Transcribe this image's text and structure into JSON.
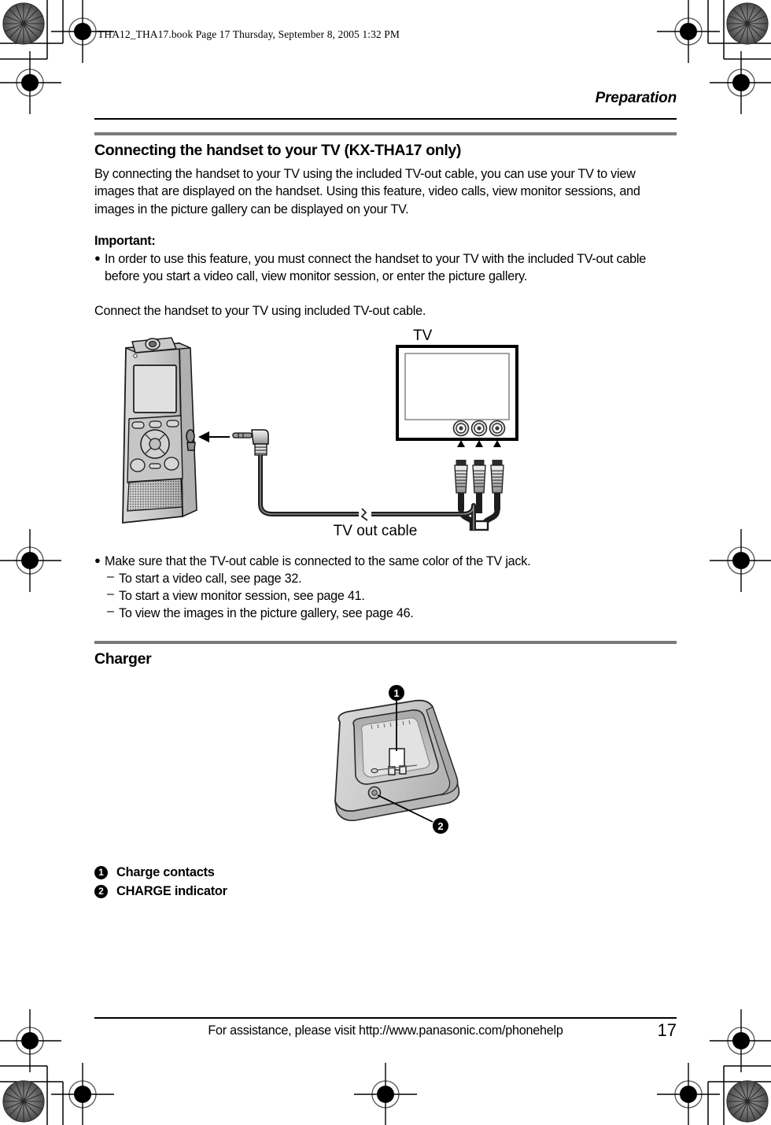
{
  "document": {
    "file_header": "THA12_THA17.book  Page 17  Thursday, September 8, 2005  1:32 PM",
    "running_head": "Preparation",
    "footer_text": "For assistance, please visit http://www.panasonic.com/phonehelp",
    "page_number": "17"
  },
  "section_tv": {
    "heading": "Connecting the handset to your TV (KX-THA17 only)",
    "intro": "By connecting the handset to your TV using the included TV-out cable, you can use your TV to view images that are displayed on the handset. Using this feature, video calls, view monitor sessions, and images in the picture gallery can be displayed on your TV.",
    "important_label": "Important:",
    "important_bullet": "In order to use this feature, you must connect the handset to your TV with the included TV-out cable before you start a video call, view monitor session, or enter the picture gallery.",
    "connect_line": "Connect the handset to your TV using included TV-out cable.",
    "figure": {
      "tv_label": "TV",
      "cable_label": "TV out cable"
    },
    "note_bullet": "Make sure that the TV-out cable is connected to the same color of the TV jack.",
    "note_dashes": [
      "To start a video call, see page 32.",
      "To start a view monitor session, see page 41.",
      "To view the images in the picture gallery, see page 46."
    ]
  },
  "section_charger": {
    "heading": "Charger",
    "callouts": [
      {
        "number": "1",
        "label": "Charge contacts"
      },
      {
        "number": "2",
        "label": "CHARGE indicator"
      }
    ],
    "figure": {
      "marker_1": "1",
      "marker_2": "2"
    }
  },
  "bullet_glyph": "●",
  "dash_glyph": "–",
  "colors": {
    "rule_gray": "#7a7a7a",
    "text": "#000000",
    "page_bg": "#ffffff",
    "device_fill": "#d4d4d4",
    "device_shade": "#bdbdbd"
  }
}
